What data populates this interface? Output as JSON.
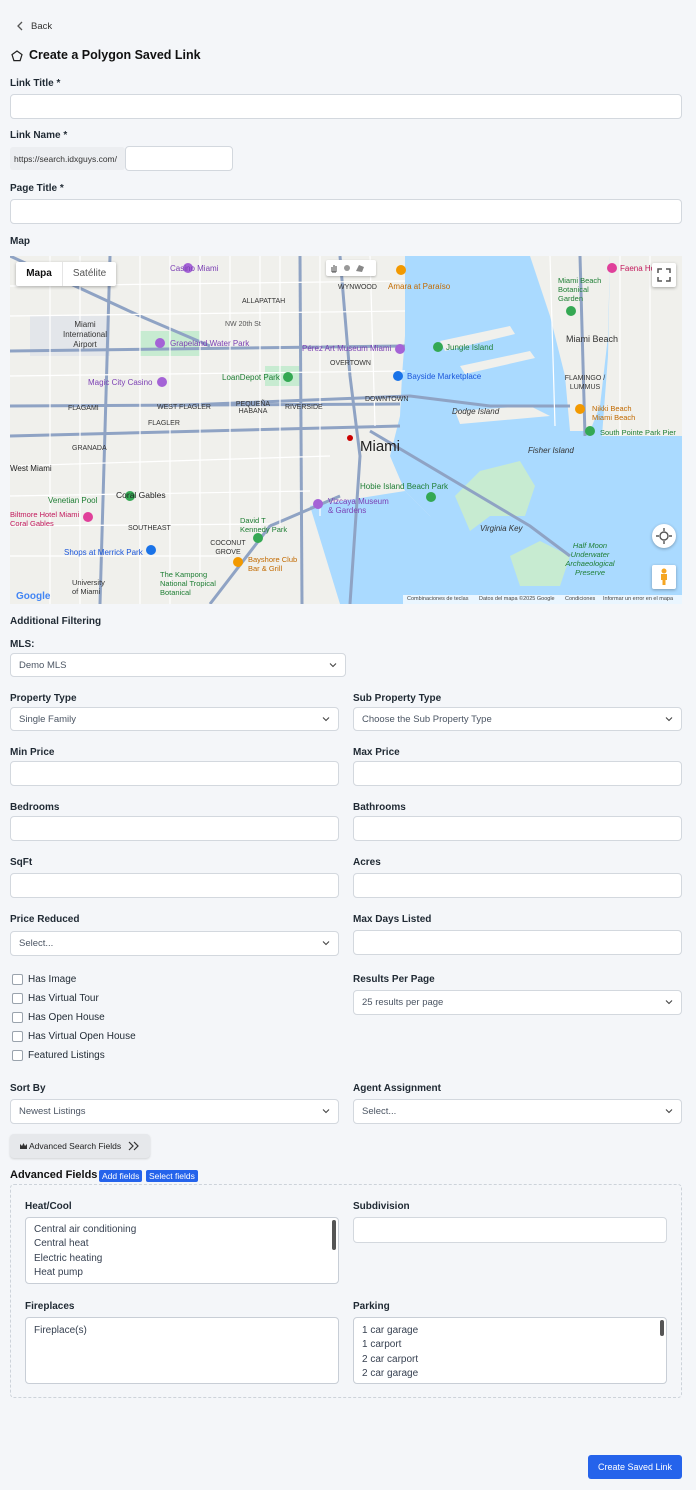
{
  "header": {
    "back_label": "Back",
    "page_title": "Create a Polygon Saved Link"
  },
  "form": {
    "link_title_label": "Link Title *",
    "link_name_label": "Link Name *",
    "link_name_prefix": "https://search.idxguys.com/",
    "page_title_label": "Page Title *",
    "map_label": "Map"
  },
  "map": {
    "tab_map": "Mapa",
    "tab_satellite": "Satélite",
    "city_label": "Miami",
    "places": {
      "miami_airport": "Miami International Airport",
      "allapattah": "ALLAPATTAH",
      "wynwood": "WYNWOOD",
      "overtown": "OVERTOWN",
      "downtown": "DOWNTOWN",
      "pequena_habana": "PEQUEÑA HABANA",
      "flagami": "FLAGAMI",
      "flagler": "FLAGLER",
      "grapeland": "Grapeland Water Park",
      "loandepot": "LoanDepot Park",
      "magic_city": "Magic City Casino",
      "perez": "Pérez Art Museum Miami",
      "jungle_island": "Jungle Island",
      "bayside": "Bayside Marketplace",
      "dodge_island": "Dodge Island",
      "miami_beach": "Miami Beach",
      "fisher_island": "Fisher Island",
      "coral_gables": "Coral Gables",
      "west_miami": "West Miami",
      "venetian_pool": "Venetian Pool",
      "biltmore": "Biltmore Hotel Miami Coral Gables",
      "vizcaya": "Vizcaya Museum & Gardens",
      "hobie": "Hobie Island Beach Park",
      "virginia_key": "Virginia Key",
      "coconut_grove": "COCONUT GROVE",
      "kennedy": "David T Kennedy Park",
      "bayshore": "Bayshore Club Bar & Grill",
      "merrick": "Shops at Merrick Park",
      "kampong": "The Kampong National Tropical Botanical",
      "half_moon": "Half Moon Underwater Archaeological Preserve",
      "casino_miami": "Casino Miami",
      "amara": "Amara at Paraíso",
      "faena": "Faena Hotel",
      "nikki": "Nikki Beach Miami Beach",
      "south_pointe": "South Pointe Park Pier",
      "fairmont": "Miami Beach Botanical Garden",
      "flamingo": "FLAMINGO / LUMMUS",
      "nw20": "NW 20th St",
      "west_flagler": "WEST FLAGLER",
      "riverside": "RIVERSIDE",
      "granada": "GRANADA",
      "southeast": "SOUTHEAST",
      "university": "University of Miami"
    },
    "attribution": {
      "shortcuts": "Combinaciones de teclas",
      "data": "Datos del mapa ©2025 Google",
      "terms": "Condiciones",
      "report": "Informar un error en el mapa"
    }
  },
  "filters": {
    "section_title": "Additional Filtering",
    "mls_label": "MLS:",
    "mls_value": "Demo MLS",
    "property_type_label": "Property Type",
    "property_type_value": "Single Family",
    "sub_property_type_label": "Sub Property Type",
    "sub_property_type_value": "Choose the Sub Property Type",
    "min_price_label": "Min Price",
    "max_price_label": "Max Price",
    "bedrooms_label": "Bedrooms",
    "bathrooms_label": "Bathrooms",
    "sqft_label": "SqFt",
    "acres_label": "Acres",
    "price_reduced_label": "Price Reduced",
    "price_reduced_value": "Select...",
    "max_days_label": "Max Days Listed",
    "checkboxes": [
      "Has Image",
      "Has Virtual Tour",
      "Has Open House",
      "Has Virtual Open House",
      "Featured Listings"
    ],
    "results_per_page_label": "Results Per Page",
    "results_per_page_value": "25 results per page",
    "sort_by_label": "Sort By",
    "sort_by_value": "Newest Listings",
    "agent_assignment_label": "Agent Assignment",
    "agent_assignment_value": "Select...",
    "advanced_search_button": "Advanced Search Fields"
  },
  "advanced": {
    "title": "Advanced Fields",
    "add_fields": "Add fields",
    "select_fields": "Select fields",
    "heat_cool_label": "Heat/Cool",
    "heat_cool_options": [
      "Central air conditioning",
      "Central heat",
      "Electric heating",
      "Heat pump"
    ],
    "subdivision_label": "Subdivision",
    "fireplaces_label": "Fireplaces",
    "fireplaces_options": [
      "Fireplace(s)"
    ],
    "parking_label": "Parking",
    "parking_options": [
      "1 car garage",
      "1 carport",
      "2 car carport",
      "2 car garage"
    ]
  },
  "footer": {
    "create_button": "Create Saved Link"
  },
  "colors": {
    "primary": "#2563eb",
    "water": "#aadaff",
    "park": "#c7ebd1",
    "land": "#f0f0ec"
  }
}
